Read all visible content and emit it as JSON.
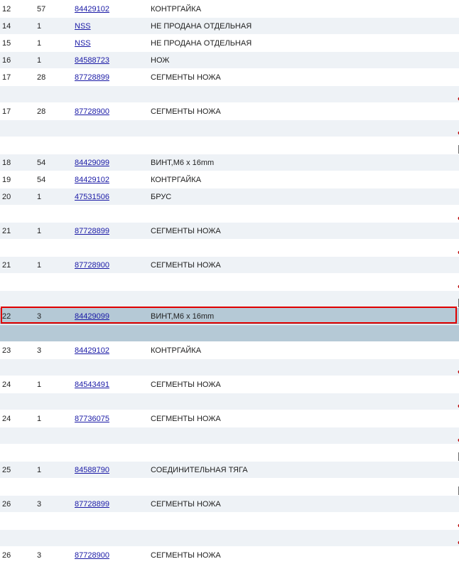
{
  "rows": [
    {
      "num": "12",
      "qty": "57",
      "part": "84429102",
      "desc": "КОНТРГАЙКА"
    },
    {
      "num": "14",
      "qty": "1",
      "part": "NSS",
      "desc": "НЕ ПРОДАНА ОТДЕЛЬНАЯ"
    },
    {
      "num": "15",
      "qty": "1",
      "part": "NSS",
      "desc": "НЕ ПРОДАНА ОТДЕЛЬНАЯ"
    },
    {
      "num": "16",
      "qty": "1",
      "part": "84588723",
      "desc": "НОЖ"
    },
    {
      "num": "17",
      "qty": "28",
      "part": "87728899",
      "desc": "СЕГМЕНТЫ НОЖА"
    },
    {
      "num": "17",
      "qty": "28",
      "part": "87728900",
      "desc": "СЕГМЕНТЫ НОЖА"
    },
    {
      "num": "18",
      "qty": "54",
      "part": "84429099",
      "desc": "ВИНТ,M6 x 16mm"
    },
    {
      "num": "19",
      "qty": "54",
      "part": "84429102",
      "desc": "КОНТРГАЙКА"
    },
    {
      "num": "20",
      "qty": "1",
      "part": "47531506",
      "desc": "БРУС"
    },
    {
      "num": "21",
      "qty": "1",
      "part": "87728899",
      "desc": "СЕГМЕНТЫ НОЖА"
    },
    {
      "num": "21",
      "qty": "1",
      "part": "87728900",
      "desc": "СЕГМЕНТЫ НОЖА"
    },
    {
      "num": "22",
      "qty": "3",
      "part": "84429099",
      "desc": "ВИНТ,M6 x 16mm"
    },
    {
      "num": "23",
      "qty": "3",
      "part": "84429102",
      "desc": "КОНТРГАЙКА"
    },
    {
      "num": "24",
      "qty": "1",
      "part": "84543491",
      "desc": "СЕГМЕНТЫ НОЖА"
    },
    {
      "num": "24",
      "qty": "1",
      "part": "87736075",
      "desc": "СЕГМЕНТЫ НОЖА"
    },
    {
      "num": "25",
      "qty": "1",
      "part": "84588790",
      "desc": "СОЕДИНИТЕЛЬНАЯ ТЯГА"
    },
    {
      "num": "26",
      "qty": "3",
      "part": "87728899",
      "desc": "СЕГМЕНТЫ НОЖА"
    },
    {
      "num": "26",
      "qty": "3",
      "part": "87728900",
      "desc": "СЕГМЕНТЫ НОЖА"
    }
  ],
  "selected_row_index": 11
}
